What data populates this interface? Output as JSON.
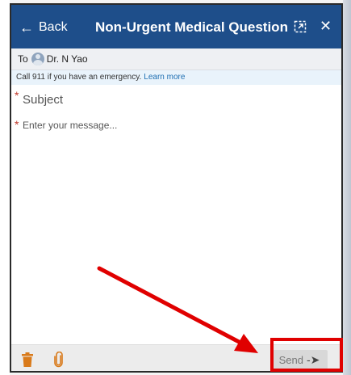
{
  "header": {
    "back_label": "Back",
    "title": "Non-Urgent Medical Question",
    "back_icon": "arrow-left-icon",
    "popout_icon": "popout-icon",
    "close_icon": "close-icon"
  },
  "recipient": {
    "to_label": "To",
    "name": "Dr. N Yao"
  },
  "notice": {
    "text": "Call 911 if you have an emergency.",
    "link": "Learn more"
  },
  "form": {
    "subject_placeholder": "Subject",
    "message_placeholder": "Enter your message...",
    "required_marker": "*"
  },
  "footer": {
    "send_label": "Send",
    "delete_icon": "trash-icon",
    "attach_icon": "paperclip-icon",
    "send_icon": "send-arrow-icon"
  },
  "colors": {
    "header_bg": "#1e4e8a",
    "required": "#c0392b",
    "link": "#1f6fb2",
    "annotation": "#e00000",
    "trash": "#d97a1a",
    "clip": "#d97a1a"
  }
}
